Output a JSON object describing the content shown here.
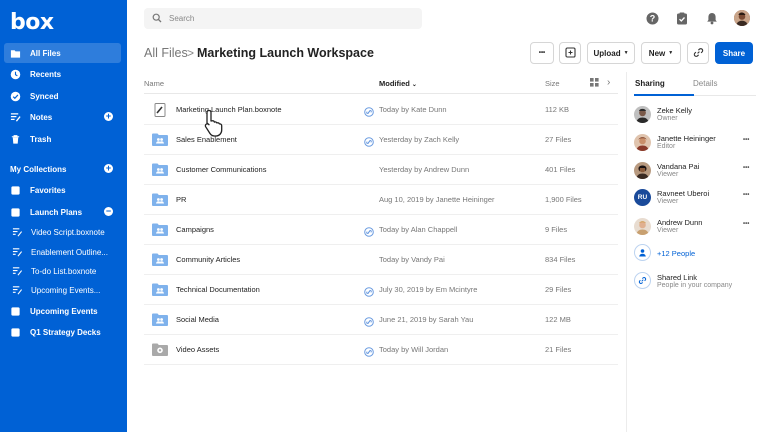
{
  "brand": {
    "logo_text": "box",
    "accent": "#0061d5"
  },
  "sidebar": {
    "items": [
      {
        "label": "All Files",
        "icon": "folder-icon",
        "active": true
      },
      {
        "label": "Recents",
        "icon": "clock-icon"
      },
      {
        "label": "Synced",
        "icon": "check-circle-icon"
      },
      {
        "label": "Notes",
        "icon": "notes-icon"
      },
      {
        "label": "Trash",
        "icon": "trash-icon"
      }
    ],
    "collections_label": "My Collections",
    "favorites_label": "Favorites",
    "launch_plans_label": "Launch Plans",
    "sub_items": [
      {
        "label": "Video Script.boxnote"
      },
      {
        "label": "Enablement Outline..."
      },
      {
        "label": "To-do List.boxnote"
      },
      {
        "label": "Upcoming Events..."
      }
    ],
    "upcoming_events_label": "Upcoming Events",
    "q1_label": "Q1 Strategy Decks"
  },
  "header": {
    "search_placeholder": "Search",
    "icons": [
      "help-icon",
      "tasks-icon",
      "bell-icon",
      "user-avatar"
    ]
  },
  "titlebar": {
    "breadcrumb_root": "All Files",
    "breadcrumb_sep": ">",
    "title": "Marketing Launch Workspace",
    "more_label": "•••",
    "upload_label": "Upload",
    "new_label": "New",
    "share_label": "Share"
  },
  "table": {
    "headers": {
      "name": "Name",
      "modified": "Modified",
      "size": "Size"
    },
    "rows": [
      {
        "name": "Marketing Launch Plan.boxnote",
        "type": "boxnote",
        "collab": true,
        "modified": "Today by Kate Dunn",
        "size": "112 KB"
      },
      {
        "name": "Sales Enablement",
        "type": "folder-shared",
        "collab": true,
        "modified": "Yesterday by Zach Kelly",
        "size": "27 Files"
      },
      {
        "name": "Customer Communications",
        "type": "folder-shared",
        "collab": false,
        "modified": "Yesterday by Andrew Dunn",
        "size": "401 Files"
      },
      {
        "name": "PR",
        "type": "folder-shared",
        "collab": false,
        "modified": "Aug 10, 2019 by Janette Heininger",
        "size": "1,900 Files"
      },
      {
        "name": "Campaigns",
        "type": "folder-shared",
        "collab": true,
        "modified": "Today by Alan Chappell",
        "size": "9 Files"
      },
      {
        "name": "Community Articles",
        "type": "folder-shared",
        "collab": false,
        "modified": "Today by Vandy Pai",
        "size": "834 Files"
      },
      {
        "name": "Technical Documentation",
        "type": "folder-shared",
        "collab": true,
        "modified": "July 30, 2019 by Em Mcintyre",
        "size": "29 Files"
      },
      {
        "name": "Social Media",
        "type": "folder-shared",
        "collab": true,
        "modified": "June 21, 2019 by Sarah Yau",
        "size": "122 MB"
      },
      {
        "name": "Video Assets",
        "type": "folder-archive",
        "collab": true,
        "modified": "Today by Will Jordan",
        "size": "21 Files"
      }
    ]
  },
  "panel": {
    "tabs": {
      "sharing": "Sharing",
      "details": "Details"
    },
    "people": [
      {
        "name": "Zeke Kelly",
        "role": "Owner",
        "avatar_color": "#3a3a3a",
        "more": false
      },
      {
        "name": "Janette Heininger",
        "role": "Editor",
        "avatar_color": "#a86a4a",
        "more": true
      },
      {
        "name": "Vandana Pai",
        "role": "Viewer",
        "avatar_color": "#4a3a2a",
        "more": true
      },
      {
        "name": "Ravneet Uberoi",
        "role": "Viewer",
        "initials": "RU",
        "avatar_color": "#1a4a9a",
        "more": true
      },
      {
        "name": "Andrew Dunn",
        "role": "Viewer",
        "avatar_color": "#d8a070",
        "more": true
      }
    ],
    "more_people": "+12 People",
    "shared_link_title": "Shared Link",
    "shared_link_sub": "People in your company",
    "more_glyph": "•••"
  }
}
